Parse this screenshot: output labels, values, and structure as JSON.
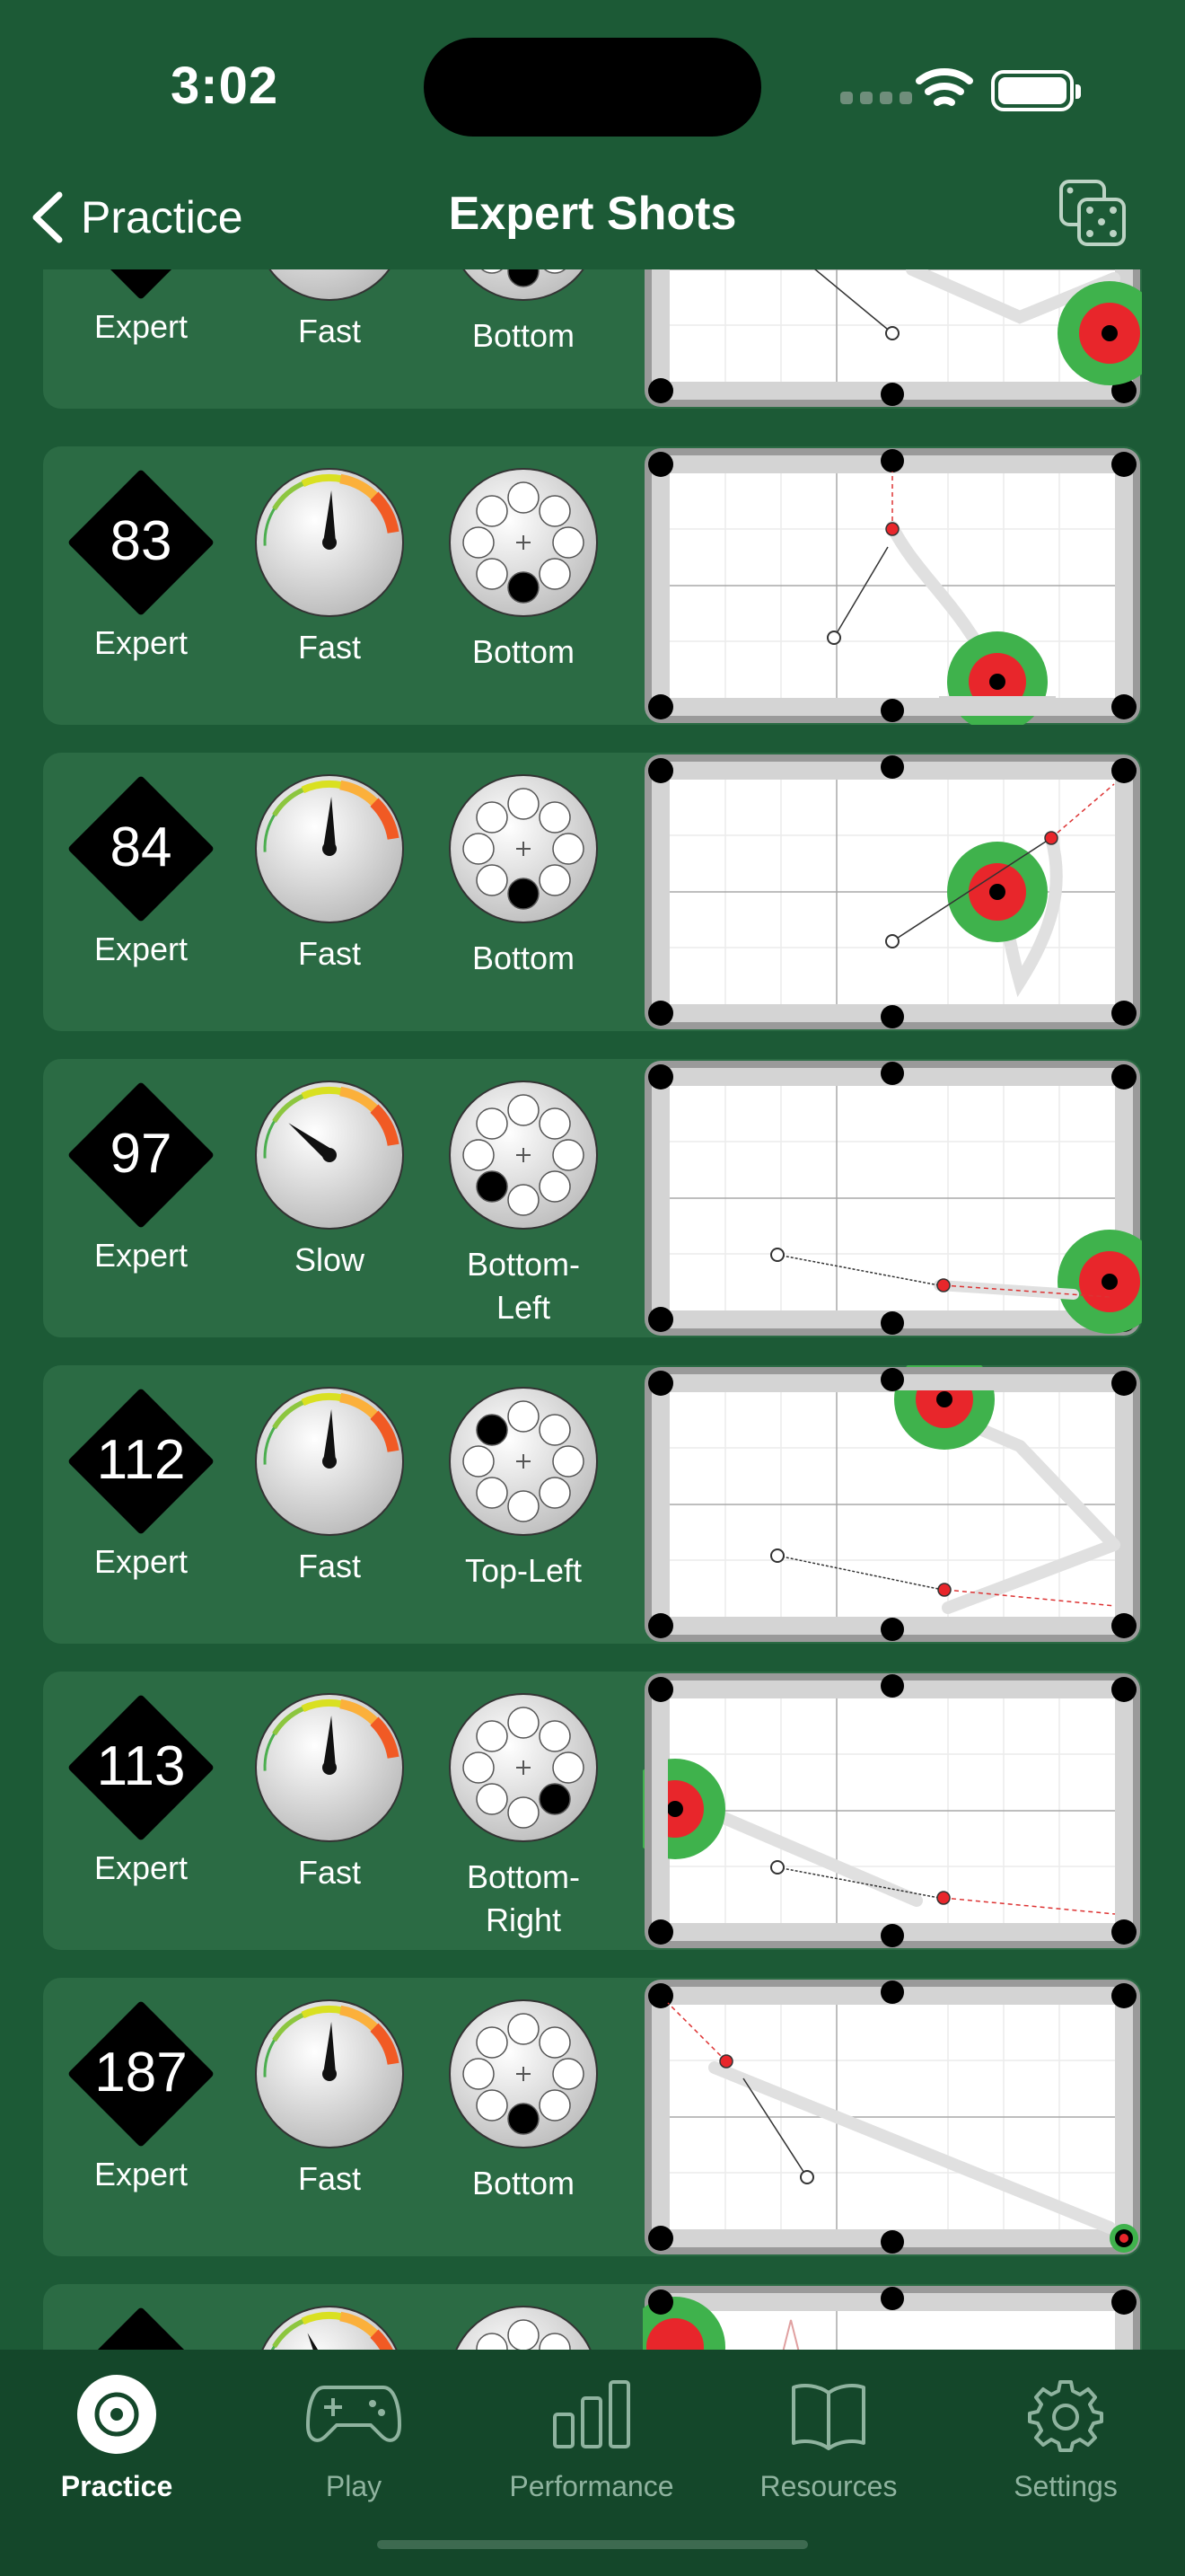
{
  "status_bar": {
    "time": "3:02"
  },
  "nav": {
    "back_label": "Practice",
    "title": "Expert Shots"
  },
  "shots": [
    {
      "number": "",
      "difficulty": "Expert",
      "speed": "Fast",
      "spin": "Bottom",
      "speed_level": 0.8,
      "spin_pos": "bottom"
    },
    {
      "number": "83",
      "difficulty": "Expert",
      "speed": "Fast",
      "spin": "Bottom",
      "speed_level": 0.8,
      "spin_pos": "bottom"
    },
    {
      "number": "84",
      "difficulty": "Expert",
      "speed": "Fast",
      "spin": "Bottom",
      "speed_level": 0.8,
      "spin_pos": "bottom"
    },
    {
      "number": "97",
      "difficulty": "Expert",
      "speed": "Slow",
      "spin": "Bottom-Left",
      "speed_level": 0.2,
      "spin_pos": "bottom-left"
    },
    {
      "number": "112",
      "difficulty": "Expert",
      "speed": "Fast",
      "spin": "Top-Left",
      "speed_level": 0.8,
      "spin_pos": "top-left"
    },
    {
      "number": "113",
      "difficulty": "Expert",
      "speed": "Fast",
      "spin": "Bottom-Right",
      "spin_label_lines": [
        "Bottom-",
        "Right"
      ],
      "speed_level": 0.8,
      "spin_pos": "bottom-right"
    },
    {
      "number": "187",
      "difficulty": "Expert",
      "speed": "Fast",
      "spin": "Bottom",
      "speed_level": 0.8,
      "spin_pos": "bottom"
    },
    {
      "number": "",
      "difficulty": "",
      "speed": "",
      "spin": "",
      "speed_level": 0.5,
      "spin_pos": "center"
    }
  ],
  "tabs": [
    {
      "label": "Practice",
      "icon": "target-icon",
      "active": true
    },
    {
      "label": "Play",
      "icon": "gamepad-icon",
      "active": false
    },
    {
      "label": "Performance",
      "icon": "bar-chart-icon",
      "active": false
    },
    {
      "label": "Resources",
      "icon": "book-icon",
      "active": false
    },
    {
      "label": "Settings",
      "icon": "gear-icon",
      "active": false
    }
  ],
  "colors": {
    "background": "#1c5a36",
    "card": "#2b6b44",
    "tabbar": "#14472a",
    "target_green": "#3fb24c",
    "target_red": "#e8262b"
  }
}
